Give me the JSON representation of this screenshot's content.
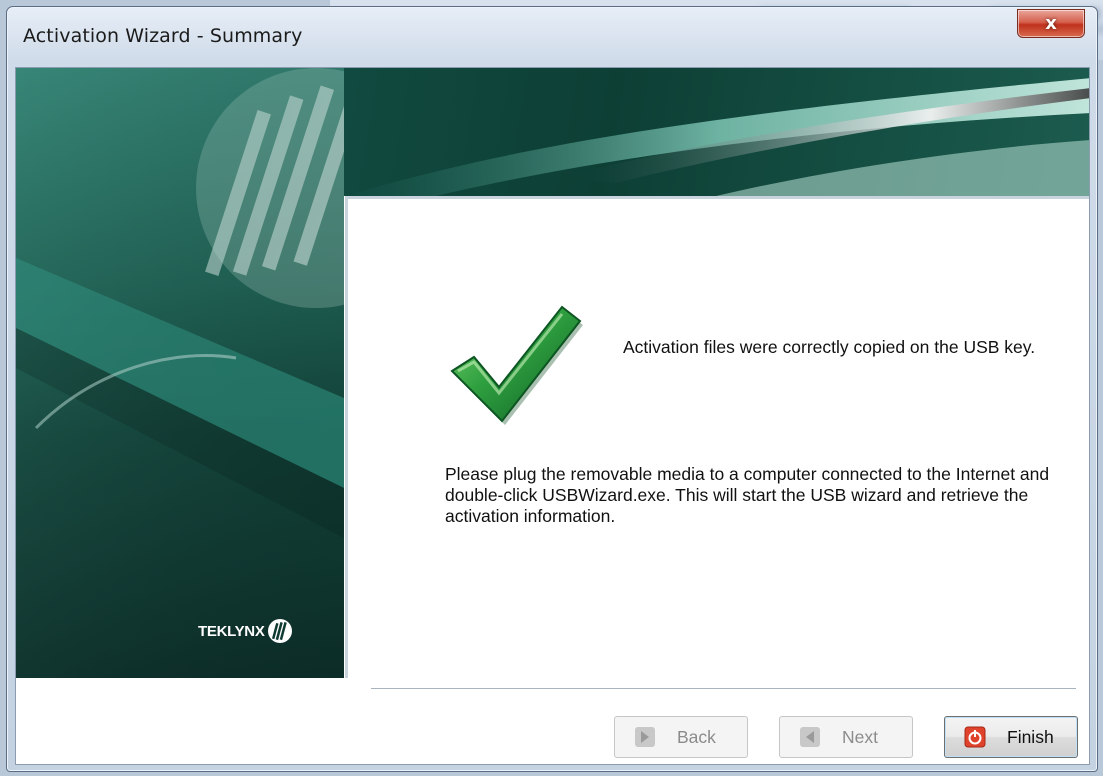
{
  "window": {
    "title": "Activation Wizard - Summary",
    "close_label": "x"
  },
  "content": {
    "success_message": "Activation files were correctly copied on the USB key.",
    "instructions": "Please plug the removable media to a computer connected to the Internet and double-click USBWizard.exe. This will start the USB wizard and retrieve the activation information."
  },
  "branding": {
    "logo_text": "TEKLYNX"
  },
  "buttons": {
    "back_label": "Back",
    "next_label": "Next",
    "finish_label": "Finish"
  },
  "icons": {
    "status": "checkmark-icon",
    "back": "back-arrow-icon",
    "next": "next-arrow-icon",
    "finish": "power-icon"
  },
  "colors": {
    "check_green": "#1e8a3e",
    "finish_red": "#e0432b",
    "brand_teal": "#1d5d50"
  }
}
